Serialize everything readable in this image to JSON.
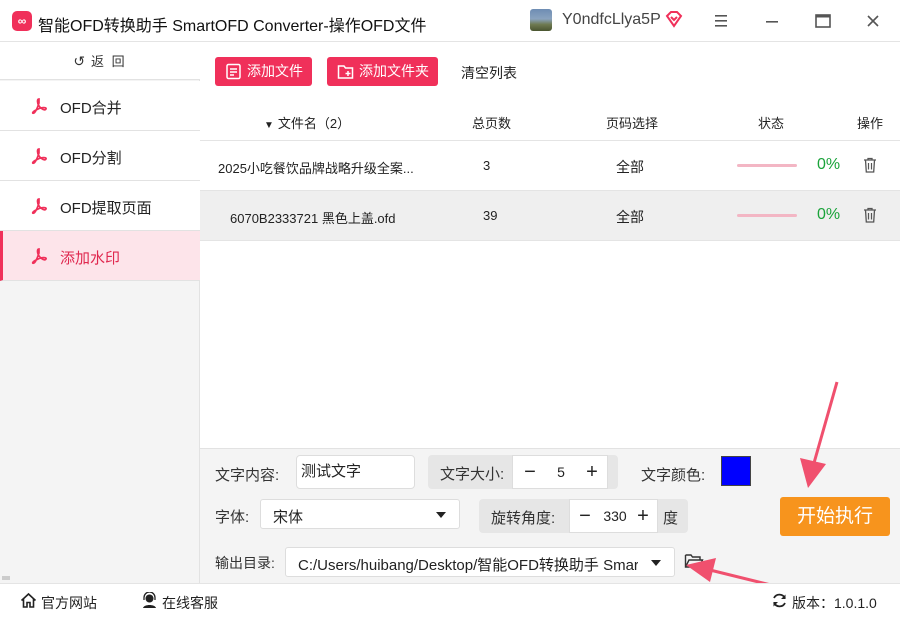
{
  "titlebar": {
    "logo_icon": "app-logo-icon",
    "title": "智能OFD转换助手 SmartOFD Converter-操作OFD文件",
    "username": "Y0ndfcLlya5P",
    "menu_label": "≡",
    "minimize_label": "—",
    "close_label": "✕"
  },
  "sidebar": {
    "back_label": "返 回",
    "items": [
      {
        "label": "OFD合并",
        "active": false
      },
      {
        "label": "OFD分割",
        "active": false
      },
      {
        "label": "OFD提取页面",
        "active": false
      },
      {
        "label": "添加水印",
        "active": true
      }
    ]
  },
  "toolbar": {
    "add_file_label": "添加文件",
    "add_folder_label": "添加文件夹",
    "clear_label": "清空列表"
  },
  "table": {
    "columns": {
      "name": "文件名（2）",
      "pages": "总页数",
      "range": "页码选择",
      "status": "状态",
      "op": "操作"
    },
    "rows": [
      {
        "name": "2025小吃餐饮品牌战略升级全案...",
        "pages": "3",
        "range": "全部",
        "progress": 0,
        "percent": "0%",
        "selected": false
      },
      {
        "name": "6070B2333721 黑色上盖.ofd",
        "pages": "39",
        "range": "全部",
        "progress": 0,
        "percent": "0%",
        "selected": true
      }
    ]
  },
  "settings": {
    "text_label": "文字内容:",
    "text_value": "测试文字",
    "size_label": "文字大小:",
    "size_value": "5",
    "color_label": "文字颜色:",
    "color_value": "#0000ff",
    "font_label": "字体:",
    "font_value": "宋体",
    "rotate_label": "旋转角度:",
    "rotate_value": "330",
    "rotate_unit": "度",
    "output_label": "输出目录:",
    "output_value": "C:/Users/huibang/Desktop/智能OFD转换助手 SmartOFD",
    "start_label": "开始执行",
    "minus_label": "−",
    "plus_label": "+"
  },
  "footer": {
    "site_label": "官方网站",
    "service_label": "在线客服",
    "version_label": "版本：1.0.1.0"
  },
  "colors": {
    "accent": "#f0305a",
    "start": "#f7941d",
    "success": "#1aa33a",
    "annotation_arrow": "#f0506e"
  }
}
